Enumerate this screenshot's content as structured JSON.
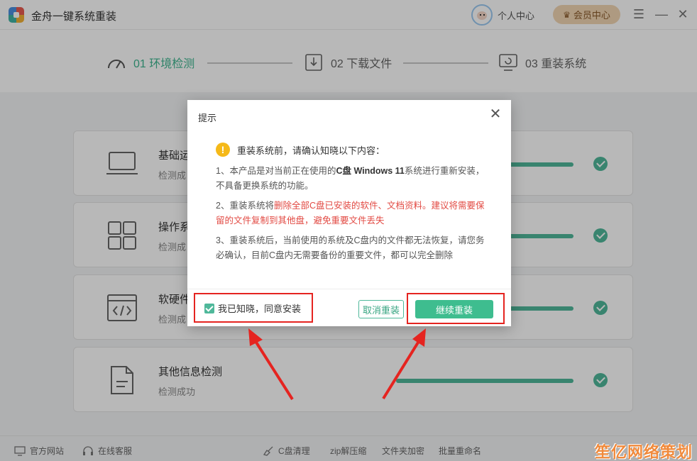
{
  "app": {
    "title": "金舟一键系统重装"
  },
  "header": {
    "personal_center": "个人中心",
    "vip_center": "会员中心"
  },
  "steps": [
    {
      "label": "01 环境检测"
    },
    {
      "label": "02 下载文件"
    },
    {
      "label": "03 重装系统"
    }
  ],
  "cards": [
    {
      "title": "基础运",
      "status": "检测成"
    },
    {
      "title": "操作系",
      "status": "检测成"
    },
    {
      "title": "软硬件",
      "status": "检测成"
    },
    {
      "title": "其他信息检测",
      "status": "检测成功"
    }
  ],
  "dialog": {
    "title": "提示",
    "heading": "重装系统前，请确认知晓以下内容：",
    "p1_a": "1、本产品是对当前正在使用的",
    "p1_b": "C盘 Windows 11",
    "p1_c": "系统进行重新安装，不具备更换系统的功能。",
    "p2_a": "2、重装系统将",
    "p2_b": "删除全部C盘已安装的软件、文档资料。建议将需要保留的文件复制到其他盘，避免重要文件丢失",
    "p3": "3、重装系统后，当前使用的系统及C盘内的文件都无法恢复，请您务必确认，目前C盘内无需要备份的重要文件，都可以完全删除",
    "agree_label": "我已知晓，同意安装",
    "cancel_label": "取消重装",
    "continue_label": "继续重装"
  },
  "footer": {
    "items": [
      "官方网站",
      "在线客服",
      "C盘清理",
      "zip解压缩",
      "文件夹加密",
      "批量重命名"
    ]
  },
  "watermark": "笙亿网络策划",
  "colors": {
    "accent": "#3ebd8f",
    "warning": "#e24a43",
    "highlight": "#e52420"
  }
}
